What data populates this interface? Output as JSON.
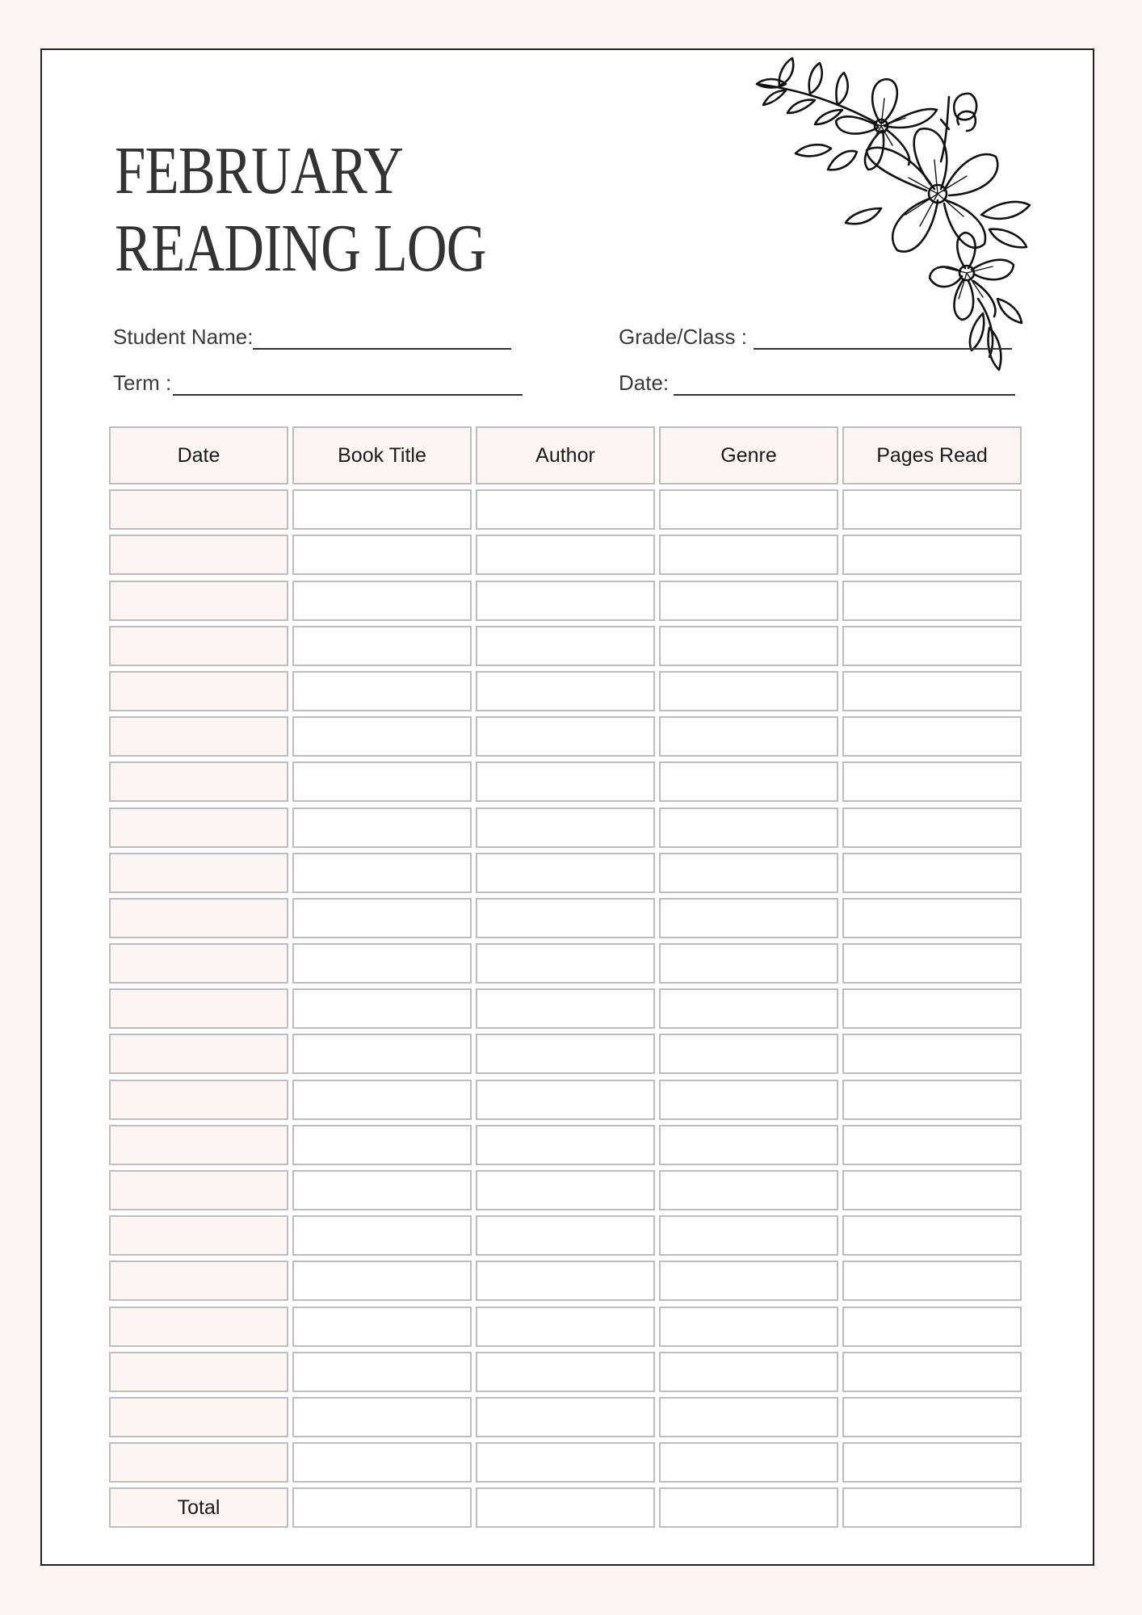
{
  "title": {
    "line1": "FEBRUARY",
    "line2": "READING LOG"
  },
  "fields": {
    "student_name": {
      "label": "Student Name:",
      "value": ""
    },
    "grade_class": {
      "label": "Grade/Class :",
      "value": ""
    },
    "term": {
      "label": "Term :",
      "value": ""
    },
    "date": {
      "label": "Date:",
      "value": ""
    }
  },
  "table": {
    "columns": [
      "Date",
      "Book Title",
      "Author",
      "Genre",
      "Pages Read"
    ],
    "row_count": 22,
    "rows": [
      [
        "",
        "",
        "",
        "",
        ""
      ],
      [
        "",
        "",
        "",
        "",
        ""
      ],
      [
        "",
        "",
        "",
        "",
        ""
      ],
      [
        "",
        "",
        "",
        "",
        ""
      ],
      [
        "",
        "",
        "",
        "",
        ""
      ],
      [
        "",
        "",
        "",
        "",
        ""
      ],
      [
        "",
        "",
        "",
        "",
        ""
      ],
      [
        "",
        "",
        "",
        "",
        ""
      ],
      [
        "",
        "",
        "",
        "",
        ""
      ],
      [
        "",
        "",
        "",
        "",
        ""
      ],
      [
        "",
        "",
        "",
        "",
        ""
      ],
      [
        "",
        "",
        "",
        "",
        ""
      ],
      [
        "",
        "",
        "",
        "",
        ""
      ],
      [
        "",
        "",
        "",
        "",
        ""
      ],
      [
        "",
        "",
        "",
        "",
        ""
      ],
      [
        "",
        "",
        "",
        "",
        ""
      ],
      [
        "",
        "",
        "",
        "",
        ""
      ],
      [
        "",
        "",
        "",
        "",
        ""
      ],
      [
        "",
        "",
        "",
        "",
        ""
      ],
      [
        "",
        "",
        "",
        "",
        ""
      ],
      [
        "",
        "",
        "",
        "",
        ""
      ],
      [
        "",
        "",
        "",
        "",
        ""
      ]
    ],
    "total_row": {
      "label": "Total",
      "values": [
        "",
        "",
        "",
        ""
      ]
    }
  },
  "decoration": {
    "icon": "floral-corner-illustration"
  },
  "colors": {
    "page_background": "#fdf5f3",
    "sheet_background": "#ffffff",
    "accent_pink": "#fdf5f3",
    "cell_border": "#bdbdbd",
    "text_dark": "#333333"
  }
}
